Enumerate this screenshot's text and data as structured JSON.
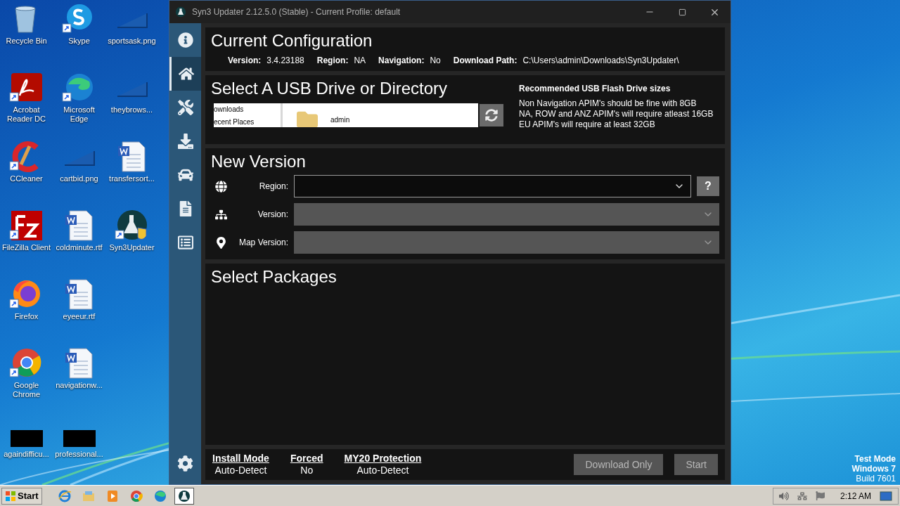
{
  "desktop": {
    "columns": [
      [
        {
          "label": "Recycle Bin",
          "kind": "recycle"
        },
        {
          "label": "Acrobat Reader DC",
          "kind": "acrobat"
        },
        {
          "label": "CCleaner",
          "kind": "ccleaner"
        },
        {
          "label": "FileZilla Client",
          "kind": "filezilla"
        },
        {
          "label": "Firefox",
          "kind": "firefox"
        },
        {
          "label": "Google Chrome",
          "kind": "chrome"
        },
        {
          "label": "againdifficu...",
          "kind": "blacked"
        }
      ],
      [
        {
          "label": "Skype",
          "kind": "skype"
        },
        {
          "label": "Microsoft Edge",
          "kind": "edge"
        },
        {
          "label": "cartbid.png",
          "kind": "image"
        },
        {
          "label": "coldminute.rtf",
          "kind": "word"
        },
        {
          "label": "eyeeur.rtf",
          "kind": "word"
        },
        {
          "label": "navigationw...",
          "kind": "word"
        },
        {
          "label": "professional...",
          "kind": "blacked"
        }
      ],
      [
        {
          "label": "sportsask.png",
          "kind": "image"
        },
        {
          "label": "theybrows...",
          "kind": "image"
        },
        {
          "label": "transfersort...",
          "kind": "word"
        },
        {
          "label": "Syn3Updater",
          "kind": "syn3"
        }
      ]
    ]
  },
  "watermark_os": [
    "Test Mode",
    "Windows 7",
    "Build 7601"
  ],
  "window": {
    "title": "Syn3 Updater 2.12.5.0 (Stable) - Current Profile: default",
    "sidebar": [
      {
        "kind": "info",
        "selected": false
      },
      {
        "kind": "home",
        "selected": true
      },
      {
        "kind": "tools",
        "selected": false
      },
      {
        "kind": "download",
        "selected": false
      },
      {
        "kind": "car",
        "selected": false
      },
      {
        "kind": "document",
        "selected": false
      },
      {
        "kind": "log",
        "selected": false
      }
    ],
    "current_configuration": {
      "heading": "Current Configuration",
      "fields": [
        {
          "label": "Version:",
          "value": "3.4.23188"
        },
        {
          "label": "Region:",
          "value": "NA"
        },
        {
          "label": "Navigation:",
          "value": "No"
        },
        {
          "label": "Download Path:",
          "value": "C:\\Users\\admin\\Downloads\\Syn3Updater\\"
        }
      ]
    },
    "usb": {
      "heading": "Select A USB Drive or Directory",
      "folders": [
        "ownloads",
        "ecent Places"
      ],
      "files": [
        "admin"
      ],
      "recommended_title": "Recommended USB Flash Drive sizes",
      "recommended_lines": [
        "Non Navigation APIM's should be fine with 8GB",
        "NA, ROW and ANZ APIM's will require atleast 16GB",
        "EU APIM's will require at least 32GB"
      ]
    },
    "new_version": {
      "heading": "New Version",
      "rows": [
        {
          "kind": "globe",
          "label": "Region:",
          "disabled": false,
          "help": "?"
        },
        {
          "kind": "tree",
          "label": "Version:",
          "disabled": true
        },
        {
          "kind": "pin",
          "label": "Map Version:",
          "disabled": true
        }
      ]
    },
    "packages": {
      "heading": "Select Packages"
    },
    "footer": {
      "settings": [
        {
          "label": "Install Mode",
          "value": "Auto-Detect"
        },
        {
          "label": "Forced",
          "value": "No"
        },
        {
          "label": "MY20 Protection",
          "value": "Auto-Detect"
        }
      ],
      "buttons": [
        "Download Only",
        "Start"
      ]
    }
  },
  "taskbar": {
    "start": "Start",
    "items": [
      {
        "kind": "ie",
        "selected": false
      },
      {
        "kind": "explorer",
        "selected": false
      },
      {
        "kind": "media",
        "selected": false
      },
      {
        "kind": "chrome",
        "selected": false
      },
      {
        "kind": "edge",
        "selected": false
      },
      {
        "kind": "syn3",
        "selected": true
      }
    ],
    "time": "2:12 AM"
  }
}
